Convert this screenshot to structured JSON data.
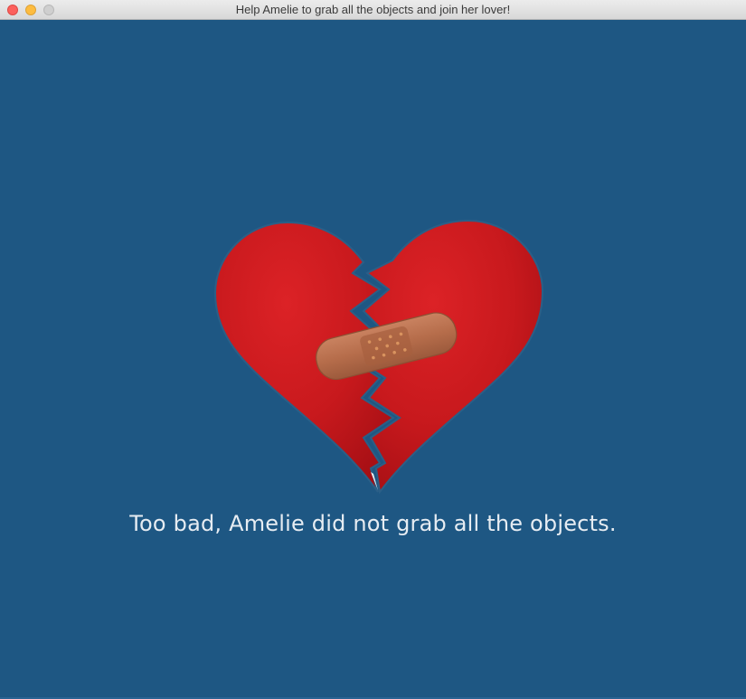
{
  "window": {
    "title": "Help Amelie to grab all the objects and join her lover!"
  },
  "game": {
    "background_color": "#1e5783",
    "image": "broken-heart-with-bandage",
    "message": "Too bad, Amelie did not grab all the objects."
  },
  "colors": {
    "heart": "#c8191d",
    "bandage": "#b9704e",
    "text": "#e6ecf2"
  }
}
